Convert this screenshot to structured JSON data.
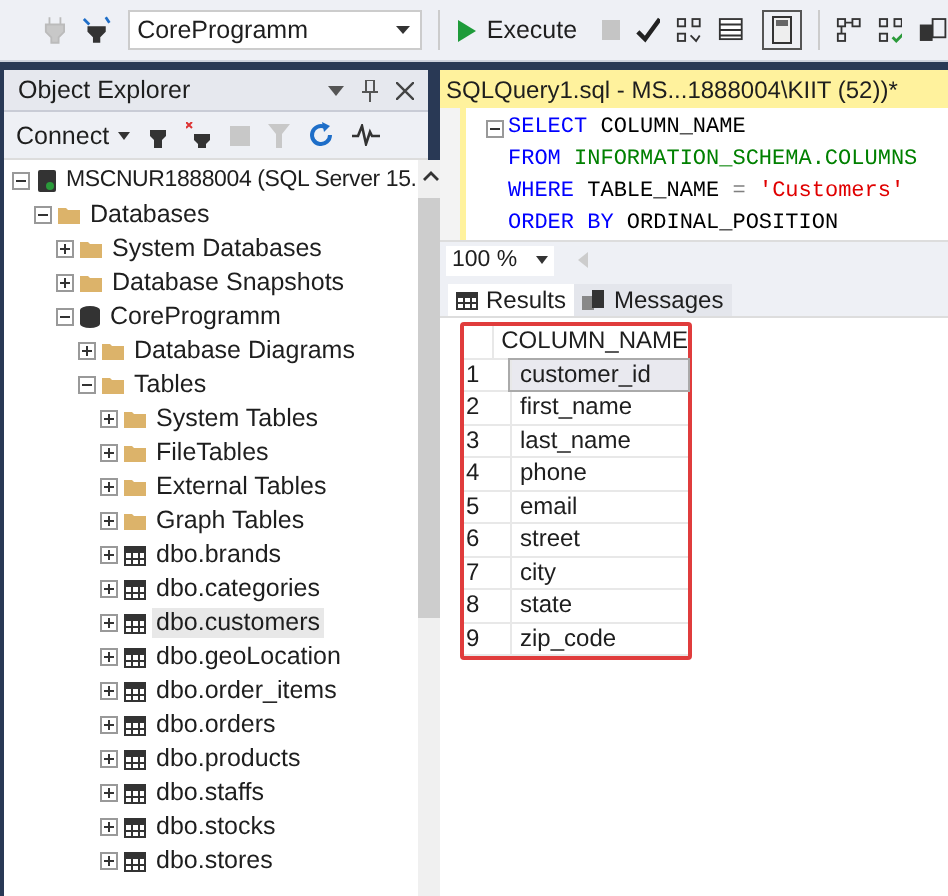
{
  "toolbar": {
    "database": "CoreProgramm",
    "execute": "Execute"
  },
  "object_explorer": {
    "title": "Object Explorer",
    "connect": "Connect",
    "tree": [
      {
        "label": "MSCNUR1888004 (SQL Server 15.",
        "kind": "server",
        "expanded": true,
        "selected": false,
        "children": [
          {
            "label": "Databases",
            "kind": "folder",
            "expanded": true,
            "selected": false,
            "children": [
              {
                "label": "System Databases",
                "kind": "folder",
                "expanded": false,
                "selected": false
              },
              {
                "label": "Database Snapshots",
                "kind": "folder",
                "expanded": false,
                "selected": false
              },
              {
                "label": "CoreProgramm",
                "kind": "database",
                "expanded": true,
                "selected": false,
                "children": [
                  {
                    "label": "Database Diagrams",
                    "kind": "folder",
                    "expanded": false,
                    "selected": false
                  },
                  {
                    "label": "Tables",
                    "kind": "folder",
                    "expanded": true,
                    "selected": false,
                    "children": [
                      {
                        "label": "System Tables",
                        "kind": "folder",
                        "expanded": false,
                        "selected": false
                      },
                      {
                        "label": "FileTables",
                        "kind": "folder",
                        "expanded": false,
                        "selected": false
                      },
                      {
                        "label": "External Tables",
                        "kind": "folder",
                        "expanded": false,
                        "selected": false
                      },
                      {
                        "label": "Graph Tables",
                        "kind": "folder",
                        "expanded": false,
                        "selected": false
                      },
                      {
                        "label": "dbo.brands",
                        "kind": "table",
                        "expanded": false,
                        "selected": false
                      },
                      {
                        "label": "dbo.categories",
                        "kind": "table",
                        "expanded": false,
                        "selected": false
                      },
                      {
                        "label": "dbo.customers",
                        "kind": "table",
                        "expanded": false,
                        "selected": true
                      },
                      {
                        "label": "dbo.geoLocation",
                        "kind": "table",
                        "expanded": false,
                        "selected": false
                      },
                      {
                        "label": "dbo.order_items",
                        "kind": "table",
                        "expanded": false,
                        "selected": false
                      },
                      {
                        "label": "dbo.orders",
                        "kind": "table",
                        "expanded": false,
                        "selected": false
                      },
                      {
                        "label": "dbo.products",
                        "kind": "table",
                        "expanded": false,
                        "selected": false
                      },
                      {
                        "label": "dbo.staffs",
                        "kind": "table",
                        "expanded": false,
                        "selected": false
                      },
                      {
                        "label": "dbo.stocks",
                        "kind": "table",
                        "expanded": false,
                        "selected": false
                      },
                      {
                        "label": "dbo.stores",
                        "kind": "table",
                        "expanded": false,
                        "selected": false
                      }
                    ]
                  }
                ]
              }
            ]
          }
        ]
      }
    ]
  },
  "query_tab": {
    "title": "SQLQuery1.sql - MS...1888004\\KIIT (52))*"
  },
  "editor": {
    "lines": [
      [
        {
          "kind": "keyword",
          "text": "SELECT"
        },
        {
          "kind": "plain",
          "text": "COLUMN_NAME"
        }
      ],
      [
        {
          "kind": "keyword",
          "text": "FROM"
        },
        {
          "kind": "object",
          "text": "INFORMATION_SCHEMA.COLUMNS"
        }
      ],
      [
        {
          "kind": "keyword",
          "text": "WHERE"
        },
        {
          "kind": "plain",
          "text": "TABLE_NAME"
        },
        {
          "kind": "operator",
          "text": "="
        },
        {
          "kind": "string",
          "text": "'Customers'"
        }
      ],
      [
        {
          "kind": "keyword",
          "text": "ORDER BY"
        },
        {
          "kind": "plain",
          "text": "ORDINAL_POSITION"
        }
      ]
    ]
  },
  "zoom": "100 %",
  "result_tabs": [
    {
      "label": "Results",
      "selected": true
    },
    {
      "label": "Messages",
      "selected": false
    }
  ],
  "results": {
    "column": "COLUMN_NAME",
    "rows": [
      {
        "n": "1",
        "value": "customer_id",
        "selected": true
      },
      {
        "n": "2",
        "value": "first_name",
        "selected": false
      },
      {
        "n": "3",
        "value": "last_name",
        "selected": false
      },
      {
        "n": "4",
        "value": "phone",
        "selected": false
      },
      {
        "n": "5",
        "value": "email",
        "selected": false
      },
      {
        "n": "6",
        "value": "street",
        "selected": false
      },
      {
        "n": "7",
        "value": "city",
        "selected": false
      },
      {
        "n": "8",
        "value": "state",
        "selected": false
      },
      {
        "n": "9",
        "value": "zip_code",
        "selected": false
      }
    ]
  }
}
